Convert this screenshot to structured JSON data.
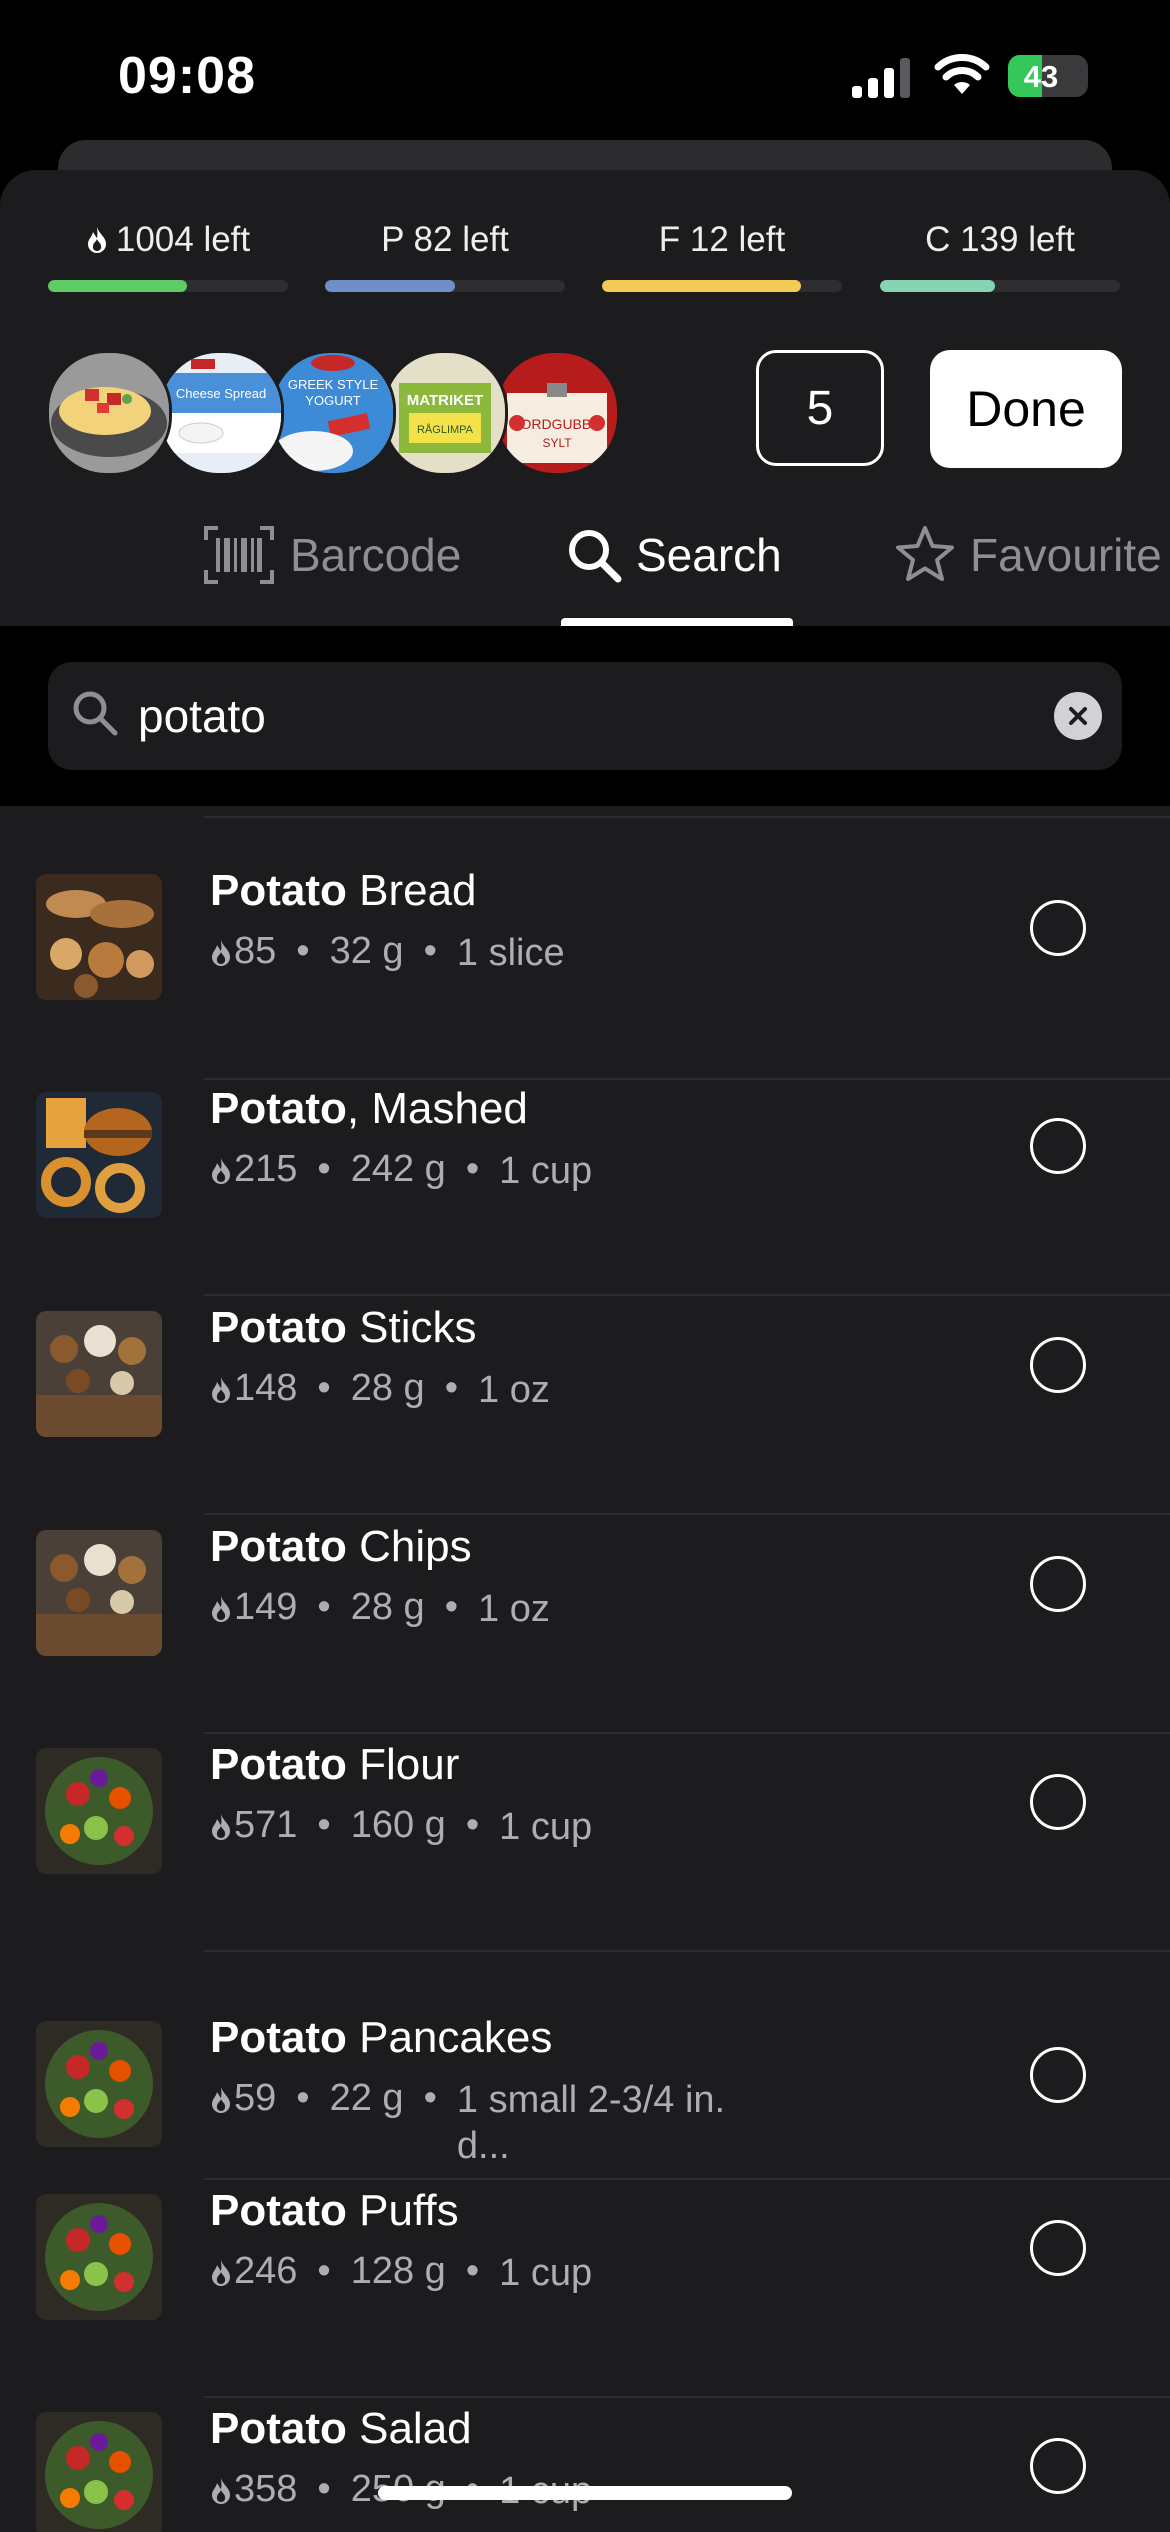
{
  "status_bar": {
    "time": "09:08",
    "battery": "43",
    "battery_level": 0.43
  },
  "macros": [
    {
      "label": "1004 left",
      "icon": "flame-icon",
      "color": "#5ecb65",
      "progress": 0.58
    },
    {
      "label": "P 82 left",
      "color": "#6e8fc9",
      "progress": 0.54
    },
    {
      "label": "F 12 left",
      "color": "#f4cb55",
      "progress": 0.83
    },
    {
      "label": "C 139 left",
      "color": "#86d4b4",
      "progress": 0.48
    }
  ],
  "selected_thumbs": [
    "omelette-thumb",
    "cheese-spread-thumb",
    "greek-yogurt-thumb",
    "bread-thumb",
    "jam-thumb"
  ],
  "count": "5",
  "done_label": "Done",
  "tabs": [
    {
      "label": "Barcode",
      "icon": "barcode-icon"
    },
    {
      "label": "Search",
      "icon": "search-icon",
      "active": true
    },
    {
      "label": "Favourite",
      "icon": "star-icon"
    }
  ],
  "search": {
    "value": "potato",
    "placeholder": ""
  },
  "results": [
    {
      "bold": "Potato",
      "rest": " Bread",
      "kcal": "85",
      "grams": "32 g",
      "serving": "1 slice",
      "image": "bread-image"
    },
    {
      "bold": "Potato",
      "rest": ", Mashed",
      "kcal": "215",
      "grams": "242 g",
      "serving": "1 cup",
      "image": "fast-food-image"
    },
    {
      "bold": "Potato",
      "rest": " Sticks",
      "kcal": "148",
      "grams": "28 g",
      "serving": "1 oz",
      "image": "snacks-image"
    },
    {
      "bold": "Potato",
      "rest": " Chips",
      "kcal": "149",
      "grams": "28 g",
      "serving": "1 oz",
      "image": "snacks-image"
    },
    {
      "bold": "Potato",
      "rest": " Flour",
      "kcal": "571",
      "grams": "160 g",
      "serving": "1 cup",
      "image": "vegetables-image"
    },
    {
      "bold": "Potato",
      "rest": " Pancakes",
      "kcal": "59",
      "grams": "22 g",
      "serving": "1 small 2-3/4 in. d...",
      "image": "vegetables-image"
    },
    {
      "bold": "Potato",
      "rest": " Puffs",
      "kcal": "246",
      "grams": "128 g",
      "serving": "1 cup",
      "image": "vegetables-image"
    },
    {
      "bold": "Potato",
      "rest": " Salad",
      "kcal": "358",
      "grams": "250 g",
      "serving": "1 cup",
      "image": "vegetables-image"
    }
  ]
}
